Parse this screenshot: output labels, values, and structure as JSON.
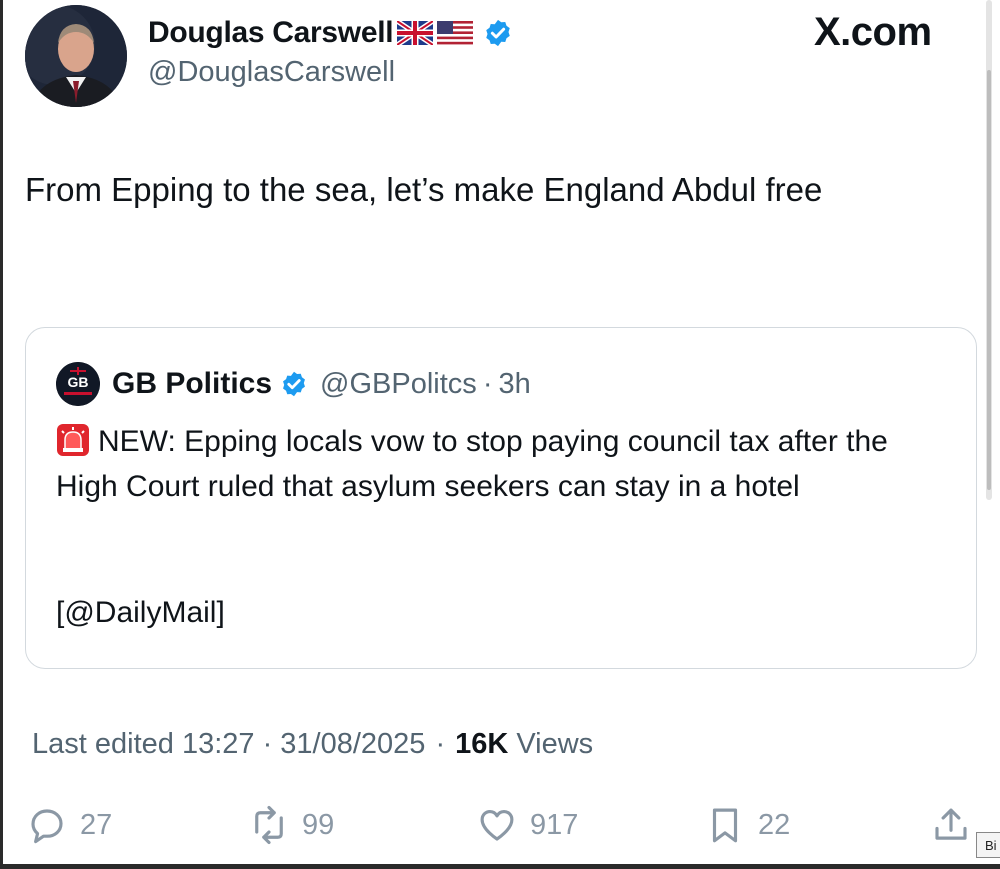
{
  "author": {
    "display_name": "Douglas Carswell",
    "handle": "@DouglasCarswell",
    "flags": [
      "uk-flag-icon",
      "us-flag-icon"
    ],
    "verified": true
  },
  "brand": "X.com",
  "tweet": {
    "text": "From Epping to the sea, let’s make England Abdul free"
  },
  "quoted_tweet": {
    "avatar_text": "GB",
    "display_name": "GB Politics",
    "handle": "@GBPolitcs",
    "separator": "·",
    "time": "3h",
    "body": "NEW: Epping locals vow to stop paying council tax after the High Court ruled that asylum seekers can stay in a hotel",
    "source": "[@DailyMail]"
  },
  "meta": {
    "edited": "Last edited 13:27 · 31/08/2025",
    "separator": "·",
    "views_count": "16K",
    "views_label": "Views"
  },
  "actions": {
    "replies": "27",
    "reposts": "99",
    "likes": "917",
    "bookmarks": "22"
  },
  "corner_tag": "Bi",
  "colors": {
    "verified_blue": "#1d9bf0",
    "secondary_text": "#536471",
    "action_gray": "#8b98a5",
    "siren_red": "#e0262d"
  }
}
